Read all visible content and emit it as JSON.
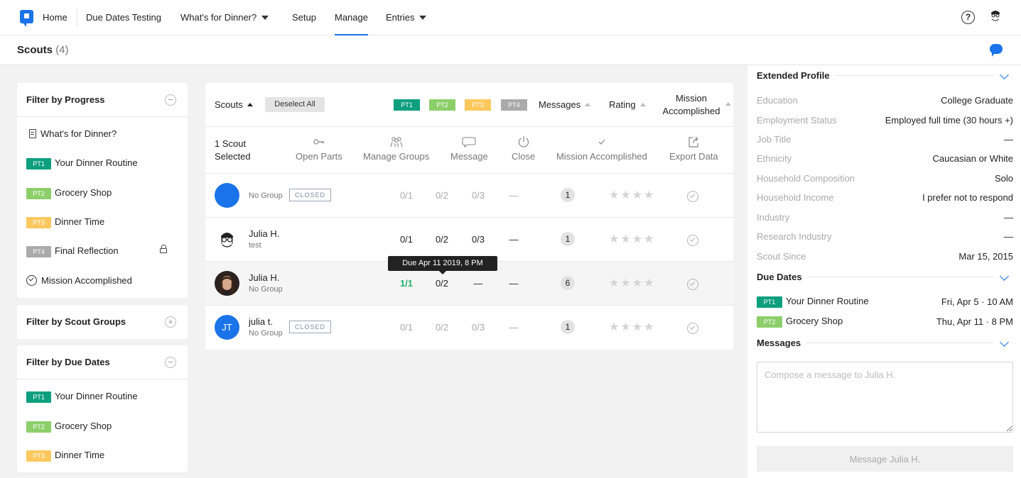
{
  "nav": {
    "home": "Home",
    "due_dates": "Due Dates Testing",
    "dinner": "What's for Dinner?",
    "setup": "Setup",
    "manage": "Manage",
    "entries": "Entries",
    "help": "?"
  },
  "subheader": {
    "title": "Scouts",
    "count": "(4)"
  },
  "part_badges": [
    {
      "label": "PT1",
      "color": "#0e9f7e"
    },
    {
      "label": "PT2",
      "color": "#8ccf6a"
    },
    {
      "label": "PT3",
      "color": "#ffc85e"
    },
    {
      "label": "PT4",
      "color": "#aaaaaa"
    }
  ],
  "filter_progress": {
    "title": "Filter by Progress",
    "mission": "What's for Dinner?",
    "parts": [
      "Your Dinner Routine",
      "Grocery Shop",
      "Dinner Time",
      "Final Reflection"
    ],
    "accomplished": "Mission Accomplished"
  },
  "filter_groups": {
    "title": "Filter by Scout Groups"
  },
  "filter_due": {
    "title": "Filter by Due Dates",
    "parts": [
      "Your Dinner Routine",
      "Grocery Shop",
      "Dinner Time"
    ]
  },
  "table": {
    "header": {
      "scouts": "Scouts",
      "deselect": "Deselect All",
      "messages": "Messages",
      "rating": "Rating",
      "mission_line1": "Mission",
      "mission_line2": "Accomplished"
    },
    "actions": {
      "selected_line1": "1 Scout",
      "selected_line2": "Selected",
      "open_parts": "Open Parts",
      "manage_groups": "Manage Groups",
      "message": "Message",
      "close": "Close",
      "mission": "Mission Accomplished",
      "export": "Export Data"
    },
    "rows": [
      {
        "name": "",
        "sub": "No Group",
        "tag": "CLOSED",
        "p1": "0/1",
        "p2": "0/2",
        "p3": "0/3",
        "p4": "—",
        "messages": "1",
        "initials": ""
      },
      {
        "name": "Julia H.",
        "sub": "test",
        "tag": "",
        "p1": "0/1",
        "p2": "0/2",
        "p3": "0/3",
        "p4": "—",
        "messages": "1",
        "initials": ""
      },
      {
        "name": "Julia H.",
        "sub": "No Group",
        "tag": "",
        "p1": "1/1",
        "p2": "0/2",
        "p3": "—",
        "p4": "—",
        "messages": "6",
        "initials": ""
      },
      {
        "name": "julia t.",
        "sub": "No Group",
        "tag": "CLOSED",
        "p1": "0/1",
        "p2": "0/2",
        "p3": "0/3",
        "p4": "—",
        "messages": "1",
        "initials": "JT"
      }
    ],
    "stars": "★★★★",
    "tooltip": "Due Apr 11 2019, 8 PM"
  },
  "profile": {
    "title": "Extended Profile",
    "rows": [
      {
        "label": "Education",
        "value": "College Graduate"
      },
      {
        "label": "Employment Status",
        "value": "Employed full time (30 hours +)"
      },
      {
        "label": "Job Title",
        "value": "—"
      },
      {
        "label": "Ethnicity",
        "value": "Caucasian or White"
      },
      {
        "label": "Household Composition",
        "value": "Solo"
      },
      {
        "label": "Household Income",
        "value": "I prefer not to respond"
      },
      {
        "label": "Industry",
        "value": "—"
      },
      {
        "label": "Research Industry",
        "value": "—"
      },
      {
        "label": "Scout Since",
        "value": "Mar 15, 2015"
      }
    ]
  },
  "due_dates": {
    "title": "Due Dates",
    "rows": [
      {
        "part": "Your Dinner Routine",
        "date": "Fri, Apr 5 · 10 AM"
      },
      {
        "part": "Grocery Shop",
        "date": "Thu, Apr 11 · 8 PM"
      }
    ]
  },
  "messages": {
    "title": "Messages",
    "placeholder": "Compose a message to Julia H.",
    "send": "Message Julia H."
  }
}
